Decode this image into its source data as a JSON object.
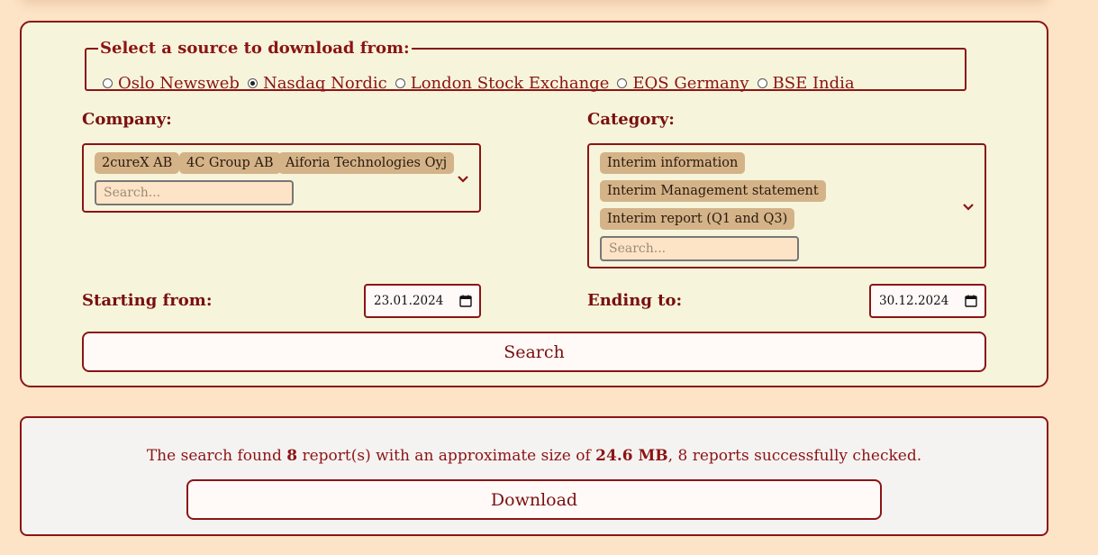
{
  "source": {
    "legend": "Select a source to download from:",
    "options": [
      {
        "label": "Oslo Newsweb",
        "checked": false
      },
      {
        "label": "Nasdaq Nordic",
        "checked": true
      },
      {
        "label": "London Stock Exchange",
        "checked": false
      },
      {
        "label": "EQS Germany",
        "checked": false
      },
      {
        "label": "BSE India",
        "checked": false
      }
    ]
  },
  "company": {
    "label": "Company:",
    "selected": [
      "2cureX AB",
      "4C Group AB",
      "Aiforia Technologies Oyj"
    ],
    "search_placeholder": "Search..."
  },
  "category": {
    "label": "Category:",
    "selected": [
      "Interim information",
      "Interim Management statement",
      "Interim report (Q1 and Q3)"
    ],
    "search_placeholder": "Search..."
  },
  "start": {
    "label": "Starting from:",
    "value": "23.01.2024"
  },
  "end": {
    "label": "Ending to:",
    "value": "30.12.2024"
  },
  "search_button": "Search",
  "result": {
    "prefix": "The search found ",
    "count": "8",
    "middle": " report(s) with an approximate size of ",
    "size": "24.6 MB",
    "suffix": ", 8 reports successfully checked."
  },
  "download_button": "Download",
  "colors": {
    "accent": "#8b1414",
    "background": "#fde4c6",
    "panel": "#f6f5dc",
    "tag": "#d4b388"
  }
}
